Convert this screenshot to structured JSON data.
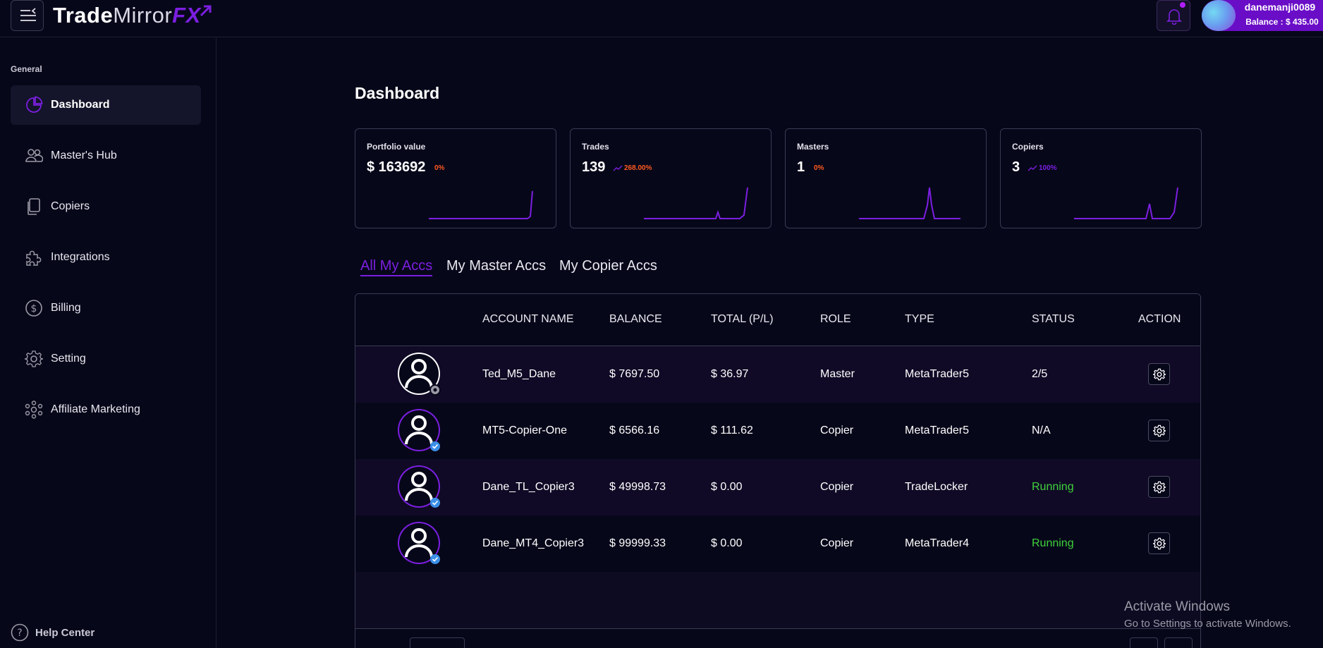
{
  "app": {
    "logo_part1": "Trade",
    "logo_part2": "Mirror",
    "logo_part3": "FX",
    "brand_color": "#7b1fe0"
  },
  "header": {
    "menu_icon": "menu-collapse-icon",
    "notification_icon": "bell-icon",
    "username": "danemanji0089",
    "balance": "Balance : $ 435.00"
  },
  "sidebar": {
    "section_label": "General",
    "items": [
      {
        "label": "Dashboard",
        "icon": "pie-chart-icon",
        "active": true
      },
      {
        "label": "Master's Hub",
        "icon": "users-icon",
        "active": false
      },
      {
        "label": "Copiers",
        "icon": "copy-icon",
        "active": false
      },
      {
        "label": "Integrations",
        "icon": "puzzle-icon",
        "active": false
      },
      {
        "label": "Billing",
        "icon": "dollar-circle-icon",
        "active": false
      },
      {
        "label": "Setting",
        "icon": "gear-icon",
        "active": false
      },
      {
        "label": "Affiliate Marketing",
        "icon": "network-icon",
        "active": false
      }
    ],
    "help_label": "Help Center"
  },
  "main": {
    "title": "Dashboard",
    "stats": [
      {
        "label": "Portfolio value",
        "value": "$ 163692",
        "delta": "0%",
        "delta_color": "#ff5a1f",
        "trend_icon": ""
      },
      {
        "label": "Trades",
        "value": "139",
        "delta": "268.00%",
        "delta_color": "#ff5a1f",
        "trend_icon": "trend-up-icon"
      },
      {
        "label": "Masters",
        "value": "1",
        "delta": "0%",
        "delta_color": "#ff5a1f",
        "trend_icon": ""
      },
      {
        "label": "Copiers",
        "value": "3",
        "delta": "100%",
        "delta_color": "#7b1fe0",
        "trend_icon": "trend-up-icon"
      }
    ],
    "tabs": [
      {
        "label": "All My Accs",
        "active": true
      },
      {
        "label": "My Master Accs",
        "active": false
      },
      {
        "label": "My Copier Accs",
        "active": false
      }
    ],
    "table": {
      "columns": [
        "ACCOUNT NAME",
        "BALANCE",
        "TOTAL (P/L)",
        "ROLE",
        "TYPE",
        "STATUS",
        "ACTION"
      ],
      "rows": [
        {
          "name": "Ted_M5_Dane",
          "balance": "$ 7697.50",
          "pl": "$ 36.97",
          "role": "Master",
          "type": "MetaTrader5",
          "status": "2/5",
          "running": false
        },
        {
          "name": "MT5-Copier-One",
          "balance": "$ 6566.16",
          "pl": "$ 111.62",
          "role": "Copier",
          "type": "MetaTrader5",
          "status": "N/A",
          "running": false
        },
        {
          "name": "Dane_TL_Copier3",
          "balance": "$ 49998.73",
          "pl": "$ 0.00",
          "role": "Copier",
          "type": "TradeLocker",
          "status": "Running",
          "running": true
        },
        {
          "name": "Dane_MT4_Copier3",
          "balance": "$ 99999.33",
          "pl": "$ 0.00",
          "role": "Copier",
          "type": "MetaTrader4",
          "status": "Running",
          "running": true
        }
      ]
    }
  },
  "watermark": {
    "title": "Activate Windows",
    "subtitle": "Go to Settings to activate Windows."
  },
  "colors": {
    "background": "#07071a",
    "accent": "#7b1fe0",
    "running": "#3fd23a",
    "negative_delta": "#ff5a1f"
  }
}
